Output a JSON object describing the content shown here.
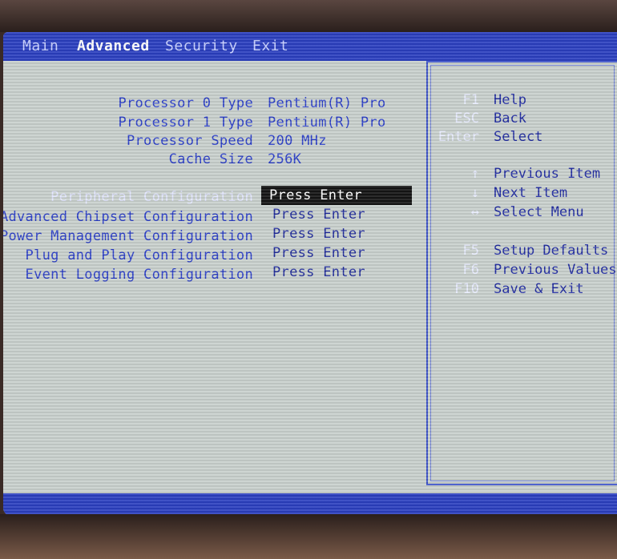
{
  "menu": {
    "items": [
      {
        "label": "Main"
      },
      {
        "label": "Advanced"
      },
      {
        "label": "Security"
      },
      {
        "label": "Exit"
      }
    ]
  },
  "info_rows": [
    {
      "label": "Processor 0 Type",
      "value": "Pentium(R) Pro"
    },
    {
      "label": "Processor 1 Type",
      "value": "Pentium(R) Pro"
    },
    {
      "label": "Processor Speed",
      "value": "200 MHz"
    },
    {
      "label": "Cache Size",
      "value": "256K"
    }
  ],
  "submenus": [
    {
      "label": "Peripheral Configuration",
      "value": "Press Enter"
    },
    {
      "label": "Advanced Chipset Configuration",
      "value": "Press Enter"
    },
    {
      "label": "Power Management Configuration",
      "value": "Press Enter"
    },
    {
      "label": "Plug and Play Configuration",
      "value": "Press Enter"
    },
    {
      "label": "Event Logging Configuration",
      "value": "Press Enter"
    }
  ],
  "help": [
    {
      "key": "F1",
      "desc": "Help"
    },
    {
      "key": "ESC",
      "desc": "Back"
    },
    {
      "key": "Enter",
      "desc": "Select"
    },
    {
      "key": "↑",
      "desc": "Previous Item"
    },
    {
      "key": "↓",
      "desc": "Next Item"
    },
    {
      "key": "↔",
      "desc": "Select Menu"
    },
    {
      "key": "F5",
      "desc": "Setup Defaults"
    },
    {
      "key": "F6",
      "desc": "Previous Values"
    },
    {
      "key": "F10",
      "desc": "Save & Exit"
    }
  ],
  "colors": {
    "screen_background": "#c9d0cd",
    "menubar": "#2b3fbf",
    "text_blue": "#2a3ec8",
    "highlight_background": "#141414"
  }
}
